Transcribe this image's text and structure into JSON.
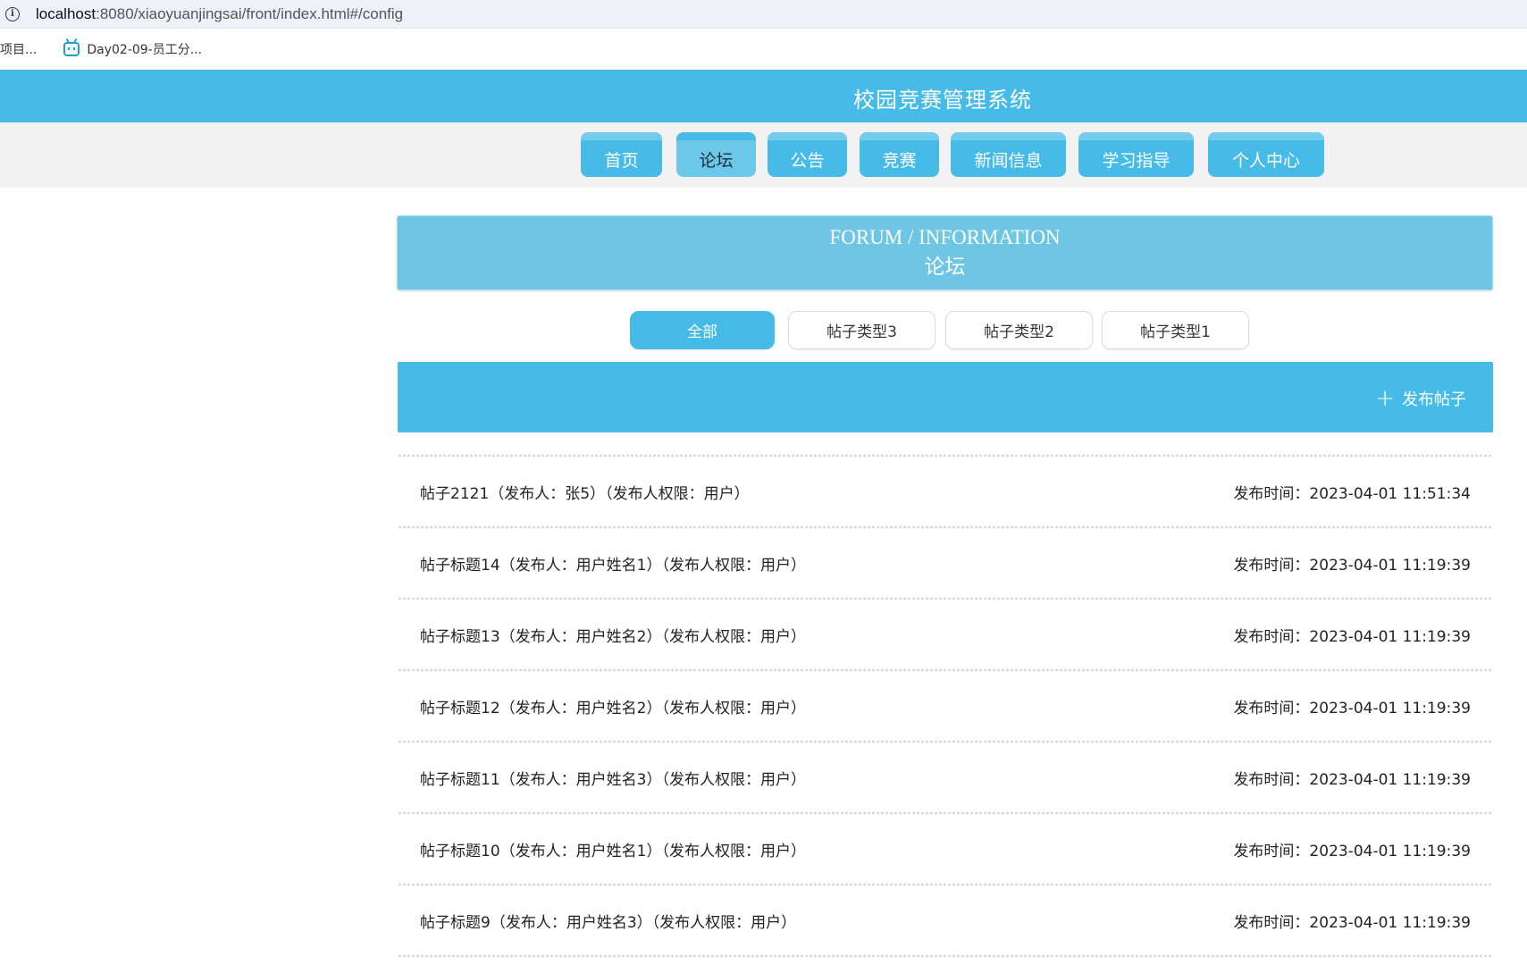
{
  "browser": {
    "url_host": "localhost",
    "url_rest": ":8080/xiaoyuanjingsai/front/index.html#/config",
    "bookmarks": [
      "项目...",
      "Day02-09-员工分..."
    ]
  },
  "header": {
    "title": "校园竞赛管理系统"
  },
  "nav": {
    "items": [
      "首页",
      "论坛",
      "公告",
      "竞赛",
      "新闻信息",
      "学习指导",
      "个人中心"
    ],
    "active": "论坛"
  },
  "banner": {
    "en": "FORUM / INFORMATION",
    "cn": "论坛"
  },
  "filters": {
    "items": [
      "全部",
      "帖子类型3",
      "帖子类型2",
      "帖子类型1"
    ],
    "active": "全部"
  },
  "post_button": {
    "label": "发布帖子",
    "icon": "plus-icon"
  },
  "colors": {
    "primary": "#47bbe7",
    "banner": "#6fc6e4",
    "nav_band": "#f2f2f2"
  },
  "posts": [
    {
      "title": "帖子2121（发布人：张5）（发布人权限：用户）",
      "time": "发布时间：2023-04-01 11:51:34"
    },
    {
      "title": "帖子标题14（发布人：用户姓名1）（发布人权限：用户）",
      "time": "发布时间：2023-04-01 11:19:39"
    },
    {
      "title": "帖子标题13（发布人：用户姓名2）（发布人权限：用户）",
      "time": "发布时间：2023-04-01 11:19:39"
    },
    {
      "title": "帖子标题12（发布人：用户姓名2）（发布人权限：用户）",
      "time": "发布时间：2023-04-01 11:19:39"
    },
    {
      "title": "帖子标题11（发布人：用户姓名3）（发布人权限：用户）",
      "time": "发布时间：2023-04-01 11:19:39"
    },
    {
      "title": "帖子标题10（发布人：用户姓名1）（发布人权限：用户）",
      "time": "发布时间：2023-04-01 11:19:39"
    },
    {
      "title": "帖子标题9（发布人：用户姓名3）（发布人权限：用户）",
      "time": "发布时间：2023-04-01 11:19:39"
    }
  ]
}
